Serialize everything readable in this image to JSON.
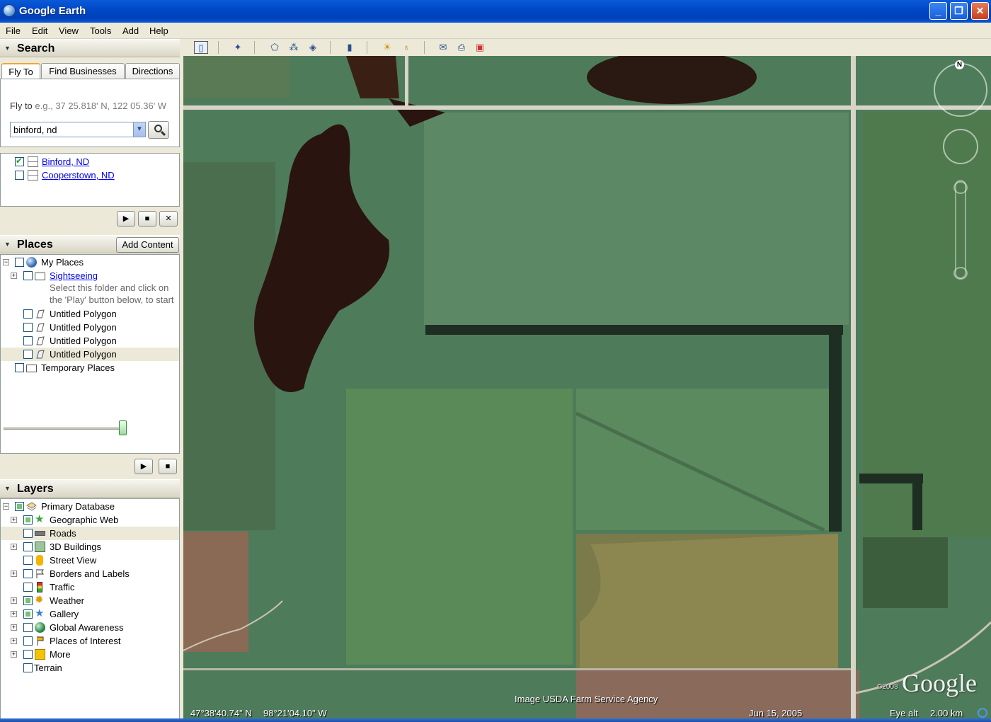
{
  "window": {
    "title": "Google Earth"
  },
  "menu": [
    "File",
    "Edit",
    "View",
    "Tools",
    "Add",
    "Help"
  ],
  "search": {
    "header": "Search",
    "tabs": [
      "Fly To",
      "Find Businesses",
      "Directions"
    ],
    "flyto_prefix": "Fly to",
    "flyto_example": "e.g., 37 25.818' N, 122 05.36' W",
    "input_value": "binford, nd",
    "results": [
      {
        "label": "Binford, ND",
        "checked": true
      },
      {
        "label": "Cooperstown, ND",
        "checked": false
      }
    ]
  },
  "places": {
    "header": "Places",
    "add_content": "Add Content",
    "items": [
      {
        "label": "My Places"
      },
      {
        "label": "Sightseeing"
      },
      {
        "note_line1": "Select this folder and click on",
        "note_line2": "the 'Play' button below, to start"
      },
      {
        "label": "Untitled Polygon"
      },
      {
        "label": "Untitled Polygon"
      },
      {
        "label": "Untitled Polygon"
      },
      {
        "label": "Untitled Polygon"
      },
      {
        "label": "Temporary Places"
      }
    ]
  },
  "layers": {
    "header": "Layers",
    "items": [
      {
        "label": "Primary Database"
      },
      {
        "label": "Geographic Web"
      },
      {
        "label": "Roads"
      },
      {
        "label": "3D Buildings"
      },
      {
        "label": "Street View"
      },
      {
        "label": "Borders and Labels"
      },
      {
        "label": "Traffic"
      },
      {
        "label": "Weather"
      },
      {
        "label": "Gallery"
      },
      {
        "label": "Global Awareness"
      },
      {
        "label": "Places of Interest"
      },
      {
        "label": "More"
      },
      {
        "label": "Terrain"
      }
    ]
  },
  "map": {
    "compass_label": "N",
    "attribution": "Image USDA Farm Service Agency",
    "copyright": "©2008",
    "logo": "Google",
    "lat": "47°38'40.74\" N",
    "lon": "98°21'04.10\" W",
    "date": "Jun 15, 2005",
    "eye_alt_label": "Eye alt",
    "eye_alt_value": "2.00 km"
  },
  "colors": {
    "titlebar": "#0a5ad8",
    "link": "#0000ee",
    "field_green": "#4f7f5c",
    "lake": "#2a1410",
    "road": "#d9d4c8"
  }
}
